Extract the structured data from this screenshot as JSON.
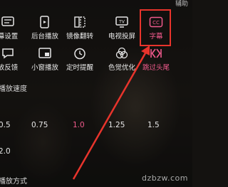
{
  "header": {
    "corner_text": "辅助"
  },
  "menu_row1": [
    {
      "label": "弹幕设置",
      "icon": "danmaku-settings-icon",
      "display": "幕设置"
    },
    {
      "label": "后台播放",
      "icon": "background-play-icon"
    },
    {
      "label": "镜像翻转",
      "icon": "mirror-flip-icon"
    },
    {
      "label": "电视投屏",
      "icon": "tv-cast-icon"
    },
    {
      "label": "字幕",
      "icon": "subtitle-cc-icon",
      "highlighted": true
    }
  ],
  "menu_row2": [
    {
      "label": "播放反馈",
      "icon": "feedback-icon",
      "display": "放反馈"
    },
    {
      "label": "小窗播放",
      "icon": "mini-window-icon"
    },
    {
      "label": "定时提醒",
      "icon": "timer-icon"
    },
    {
      "label": "色觉优化",
      "icon": "color-vision-icon"
    },
    {
      "label": "跳过头尾",
      "icon": "skip-intro-icon",
      "highlighted": true
    }
  ],
  "speed": {
    "title": "播放速度",
    "title_display": "播放速度",
    "options": [
      "0.5",
      "0.75",
      "1.0",
      "1.25",
      "1.5",
      "2.0"
    ],
    "selected": "1.0"
  },
  "playback_mode": {
    "title": "播放方式"
  },
  "watermark": "dzbzw.com",
  "colors": {
    "accent": "#f05a8c",
    "annotation": "#e8342c",
    "text": "#eaeaea"
  }
}
